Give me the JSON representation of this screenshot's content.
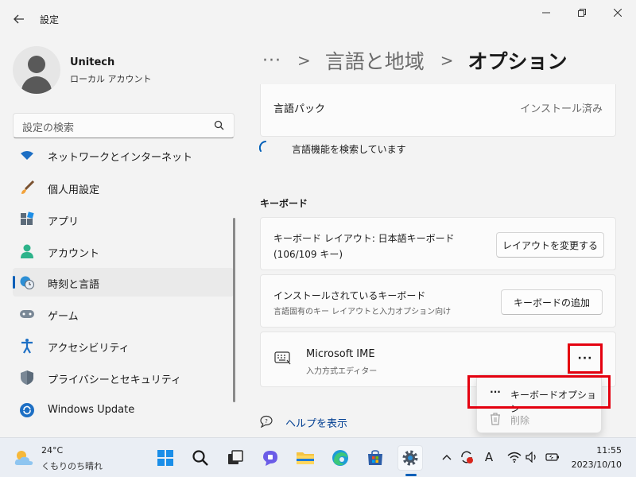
{
  "window": {
    "title": "設定",
    "back_icon": "arrow-left-icon",
    "controls": [
      "minimize-icon",
      "restore-icon",
      "close-icon"
    ]
  },
  "user": {
    "name": "Unitech",
    "account_type": "ローカル アカウント"
  },
  "search": {
    "placeholder": "設定の検索"
  },
  "sidebar": {
    "items": [
      {
        "label": "ネットワークとインターネット",
        "icon": "network-icon"
      },
      {
        "label": "個人用設定",
        "icon": "paintbrush-icon"
      },
      {
        "label": "アプリ",
        "icon": "apps-icon"
      },
      {
        "label": "アカウント",
        "icon": "account-icon"
      },
      {
        "label": "時刻と言語",
        "icon": "time-language-icon",
        "selected": true
      },
      {
        "label": "ゲーム",
        "icon": "gamepad-icon"
      },
      {
        "label": "アクセシビリティ",
        "icon": "accessibility-icon"
      },
      {
        "label": "プライバシーとセキュリティ",
        "icon": "shield-icon"
      },
      {
        "label": "Windows Update",
        "icon": "windows-update-icon"
      }
    ]
  },
  "breadcrumb": {
    "more": "···",
    "separator": ">",
    "parent": "言語と地域",
    "current": "オプション"
  },
  "language_pack": {
    "label": "言語パック",
    "status": "インストール済み"
  },
  "searching_features": "言語機能を検索しています",
  "keyboard_section": {
    "heading": "キーボード",
    "layout_card": {
      "title_line1": "キーボード レイアウト: 日本語キーボード",
      "title_line2": "(106/109 キー)",
      "button": "レイアウトを変更する"
    },
    "installed_card": {
      "title": "インストールされているキーボード",
      "subtitle": "言語固有のキー レイアウトと入力オプション向け",
      "button": "キーボードの追加"
    },
    "ime_card": {
      "name": "Microsoft IME",
      "description": "入力方式エディター",
      "more": "···"
    }
  },
  "context_menu": {
    "items": [
      {
        "label": "キーボードオプション",
        "icon": "more-icon",
        "glyph": "···"
      },
      {
        "label": "削除",
        "icon": "trash-icon",
        "disabled": true
      }
    ]
  },
  "help_link": "ヘルプを表示",
  "taskbar": {
    "weather": {
      "temp": "24°C",
      "desc": "くもりのち晴れ"
    },
    "apps": [
      "start-icon",
      "search-icon",
      "task-view-icon",
      "teams-chat-icon",
      "file-explorer-icon",
      "edge-icon",
      "store-icon",
      "settings-icon"
    ],
    "tray": {
      "ime_mode": "A"
    },
    "clock": {
      "time": "11:55",
      "date": "2023/10/10"
    }
  },
  "colors": {
    "accent": "#005fb8",
    "highlight_box": "#e4000f",
    "link": "#003e92"
  }
}
